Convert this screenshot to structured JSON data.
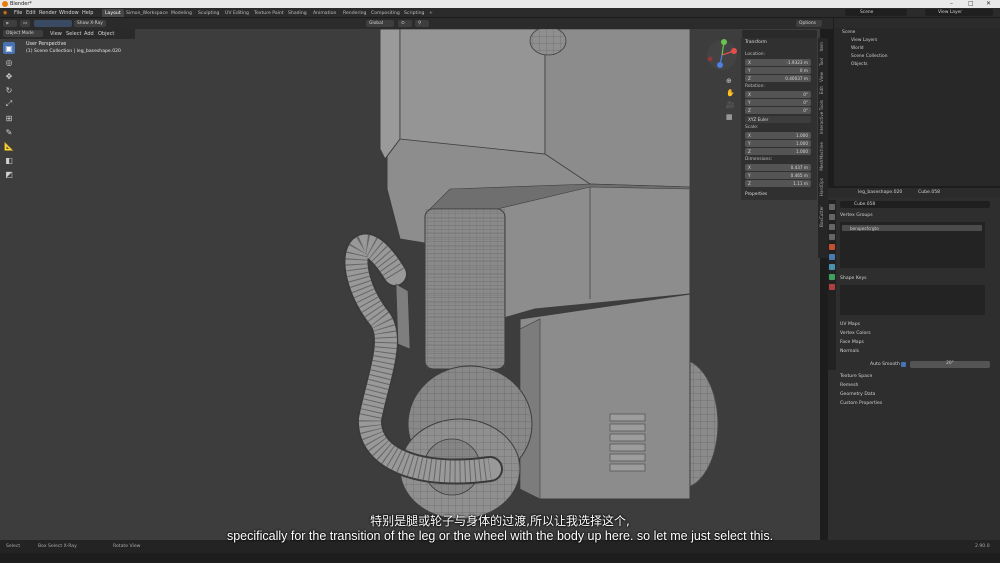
{
  "window": {
    "title": "Blender*"
  },
  "menus": [
    "File",
    "Edit",
    "Render",
    "Window",
    "Help"
  ],
  "workspace_tabs": [
    {
      "label": "Layout",
      "active": true
    },
    {
      "label": "Simon_Workspace",
      "active": false
    },
    {
      "label": "Modeling",
      "active": false
    },
    {
      "label": "Sculpting",
      "active": false
    },
    {
      "label": "UV Editing",
      "active": false
    },
    {
      "label": "Texture Paint",
      "active": false
    },
    {
      "label": "Shading",
      "active": false
    },
    {
      "label": "Animation",
      "active": false
    },
    {
      "label": "Rendering",
      "active": false
    },
    {
      "label": "Compositing",
      "active": false
    },
    {
      "label": "Scripting",
      "active": false
    }
  ],
  "top_right": {
    "scene": "Scene",
    "view_layer": "View Layer"
  },
  "tool_header": {
    "xray_label": "Show X-Ray",
    "orientation": "Global",
    "options": "Options"
  },
  "viewport_header": {
    "mode": "Object Mode",
    "menu": [
      "View",
      "Select",
      "Add",
      "Object"
    ]
  },
  "viewport_overlay": {
    "perspective": "User Perspective",
    "collection": "(1) Scene Collection | leg_baseshape.020"
  },
  "npanel": {
    "section": "Transform",
    "location_label": "Location:",
    "location": [
      {
        "ax": "X",
        "v": "-1.9323 m"
      },
      {
        "ax": "Y",
        "v": "0 m"
      },
      {
        "ax": "Z",
        "v": "0.40037 m"
      }
    ],
    "rotation_label": "Rotation:",
    "rotation": [
      {
        "ax": "X",
        "v": "0°"
      },
      {
        "ax": "Y",
        "v": "0°"
      },
      {
        "ax": "Z",
        "v": "0°"
      }
    ],
    "rotation_mode": "XYZ Euler",
    "scale_label": "Scale:",
    "scale": [
      {
        "ax": "X",
        "v": "1.000"
      },
      {
        "ax": "Y",
        "v": "1.000"
      },
      {
        "ax": "Z",
        "v": "1.000"
      }
    ],
    "dimensions_label": "Dimensions:",
    "dimensions": [
      {
        "ax": "X",
        "v": "0.437 m"
      },
      {
        "ax": "Y",
        "v": "0.465 m"
      },
      {
        "ax": "Z",
        "v": "1.11 m"
      }
    ],
    "properties": "Properties"
  },
  "side_tabs": [
    "Item",
    "Tool",
    "View",
    "Edit",
    "Interactive Tools",
    "MeshMachine",
    "HardOps",
    "BoxCutter"
  ],
  "outliner": {
    "rows": [
      "Scene",
      "View Layers",
      "World",
      "Scene Collection",
      "Objects"
    ]
  },
  "properties": {
    "object_name": "leg_baseshape.020",
    "mesh_name": "Cube.058",
    "datablock": "Cube.058",
    "vertex_groups": "Vertex Groups",
    "vertex_group_item": "benqiesfcrgto",
    "shape_keys": "Shape Keys",
    "uv_maps": "UV Maps",
    "vertex_colors": "Vertex Colors",
    "face_maps": "Face Maps",
    "normals": "Normals",
    "auto_smooth": "Auto Smooth",
    "auto_smooth_angle": "20°",
    "texture_space": "Texture Space",
    "remesh": "Remesh",
    "geometry_data": "Geometry Data",
    "custom_properties": "Custom Properties"
  },
  "status_bar": {
    "select": "Select",
    "box_select": "Box Select X-Ray",
    "rotate": "Rotate View",
    "version": "2.90.0"
  },
  "subtitles": {
    "cn": "特别是腿或轮子与身体的过渡,所以让我选择这个,",
    "en": "specifically for the transition of the leg or the wheel with the body up here. so let me just select this."
  },
  "colors": {
    "accent": "#4772b3",
    "viewport_bg": "#3d3d3d",
    "mesh": "#8a8a8a"
  }
}
